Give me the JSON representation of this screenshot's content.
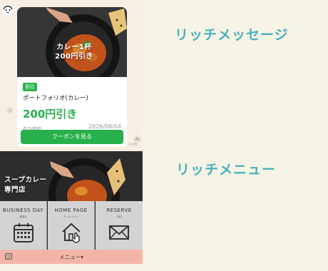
{
  "labels": {
    "rich_message": "リッチメッセージ",
    "rich_menu": "リッチメニュー"
  },
  "chat": {
    "hero_text_line1": "カレー1杯",
    "hero_text_line2": "200円引き",
    "badge": "割引",
    "title": "ポートフォリオ(カレー)",
    "price": "200円引き",
    "expiry_label": "有効期間",
    "expiry_date": "2026/08/04",
    "button": "クーポンを見る",
    "time": "2:06"
  },
  "rich_menu": {
    "shop_line1": "スープカレー",
    "shop_line2": "専門店",
    "tiles": [
      {
        "en": "BUSINESS DAY",
        "jp": "営業日",
        "icon": "calendar-icon"
      },
      {
        "en": "HOME PAGE",
        "jp": "ホームページ",
        "icon": "home-pointer-icon"
      },
      {
        "en": "RESERVE",
        "jp": "予約",
        "icon": "envelope-icon"
      }
    ],
    "bar_label": "メニュー▾",
    "bar_icon": "keyboard-icon"
  },
  "colors": {
    "line_green": "#27b04b",
    "accent_teal": "#4ab0bb",
    "menu_bar": "#f4b5a9",
    "background": "#f6f4e6"
  }
}
